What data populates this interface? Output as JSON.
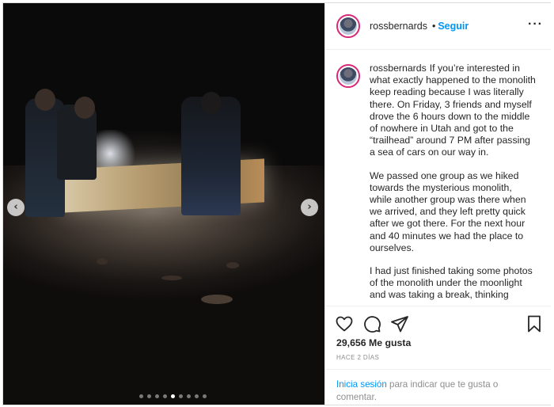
{
  "post": {
    "username": "rossbernards",
    "separator": "•",
    "follow_label": "Seguir",
    "more_label": "···",
    "caption_paragraphs": [
      "If you’re interested in what exactly happened to the monolith keep reading because I was literally there. On Friday, 3 friends and myself drove the 6 hours down to the middle of nowhere in Utah and got to the “trailhead” around 7 PM after passing a sea of cars on our way in.",
      "We passed one group as we hiked towards the mysterious monolith, while another group was there when we arrived, and they left pretty quick after we got there. For the next hour and 40 minutes we had the place to ourselves.",
      "I had just finished taking some photos of the monolith under the moonlight and was taking a break, thinking"
    ],
    "likes": "29,656 Me gusta",
    "time_ago": "HACE 2 DÍAS",
    "login_link": "Inicia sesión",
    "login_rest": " para indicar que te gusta o comentar."
  },
  "carousel": {
    "prev_label": "‹",
    "next_label": "›",
    "slide_count": 9,
    "active_index": 4
  },
  "icons": {
    "like": "heart-icon",
    "comment": "comment-icon",
    "share": "share-icon",
    "save": "bookmark-icon"
  },
  "colors": {
    "link": "#0095f6",
    "avatar_ring": "#d62976",
    "muted": "#8e8e8e"
  }
}
